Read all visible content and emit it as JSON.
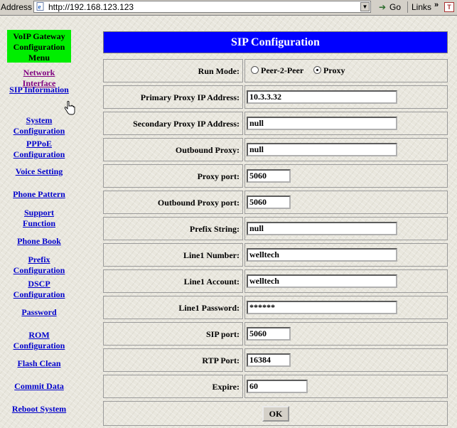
{
  "browser": {
    "address_label": "Address",
    "url": "http://192.168.123.123",
    "go_label": "Go",
    "links_label": "Links",
    "links_more": "»"
  },
  "menu": {
    "header_lines": [
      "VoIP Gateway",
      "Configuration",
      "Menu"
    ],
    "items": [
      {
        "lines": [
          "Network",
          "Interface"
        ],
        "visited": true
      },
      {
        "lines": [
          "SIP Information"
        ]
      },
      {
        "lines": [
          "System",
          "Configuration"
        ]
      },
      {
        "lines": [
          "PPPoE",
          "Configuration"
        ]
      },
      {
        "lines": [
          "Voice Setting"
        ]
      },
      {
        "lines": [
          "Phone Pattern"
        ]
      },
      {
        "lines": [
          "Support",
          "Function"
        ]
      },
      {
        "lines": [
          "Phone Book"
        ]
      },
      {
        "lines": [
          "Prefix",
          "Configuration"
        ]
      },
      {
        "lines": [
          "DSCP",
          "Configuration"
        ]
      },
      {
        "lines": [
          "Password"
        ]
      },
      {
        "lines": [
          "ROM",
          "Configuration"
        ]
      },
      {
        "lines": [
          "Flash Clean"
        ]
      },
      {
        "lines": [
          "Commit Data"
        ]
      },
      {
        "lines": [
          "Reboot System"
        ]
      }
    ]
  },
  "form": {
    "title": "SIP Configuration",
    "run_mode": {
      "label": "Run Mode:",
      "options": [
        "Peer-2-Peer",
        "Proxy"
      ],
      "selected": "Proxy"
    },
    "fields": [
      {
        "label": "Primary Proxy IP Address:",
        "value": "10.3.3.32"
      },
      {
        "label": "Secondary Proxy IP Address:",
        "value": "null"
      },
      {
        "label": "Outbound Proxy:",
        "value": "null"
      },
      {
        "label": "Proxy port:",
        "value": "5060"
      },
      {
        "label": "Outbound Proxy port:",
        "value": "5060"
      },
      {
        "label": "Prefix String:",
        "value": "null"
      },
      {
        "label": "Line1 Number:",
        "value": "welltech"
      },
      {
        "label": "Line1 Account:",
        "value": "welltech"
      },
      {
        "label": "Line1 Password:",
        "value": "******"
      },
      {
        "label": "SIP port:",
        "value": "5060"
      },
      {
        "label": "RTP Port:",
        "value": "16384"
      },
      {
        "label": "Expire:",
        "value": "60"
      }
    ],
    "ok_label": "OK"
  }
}
